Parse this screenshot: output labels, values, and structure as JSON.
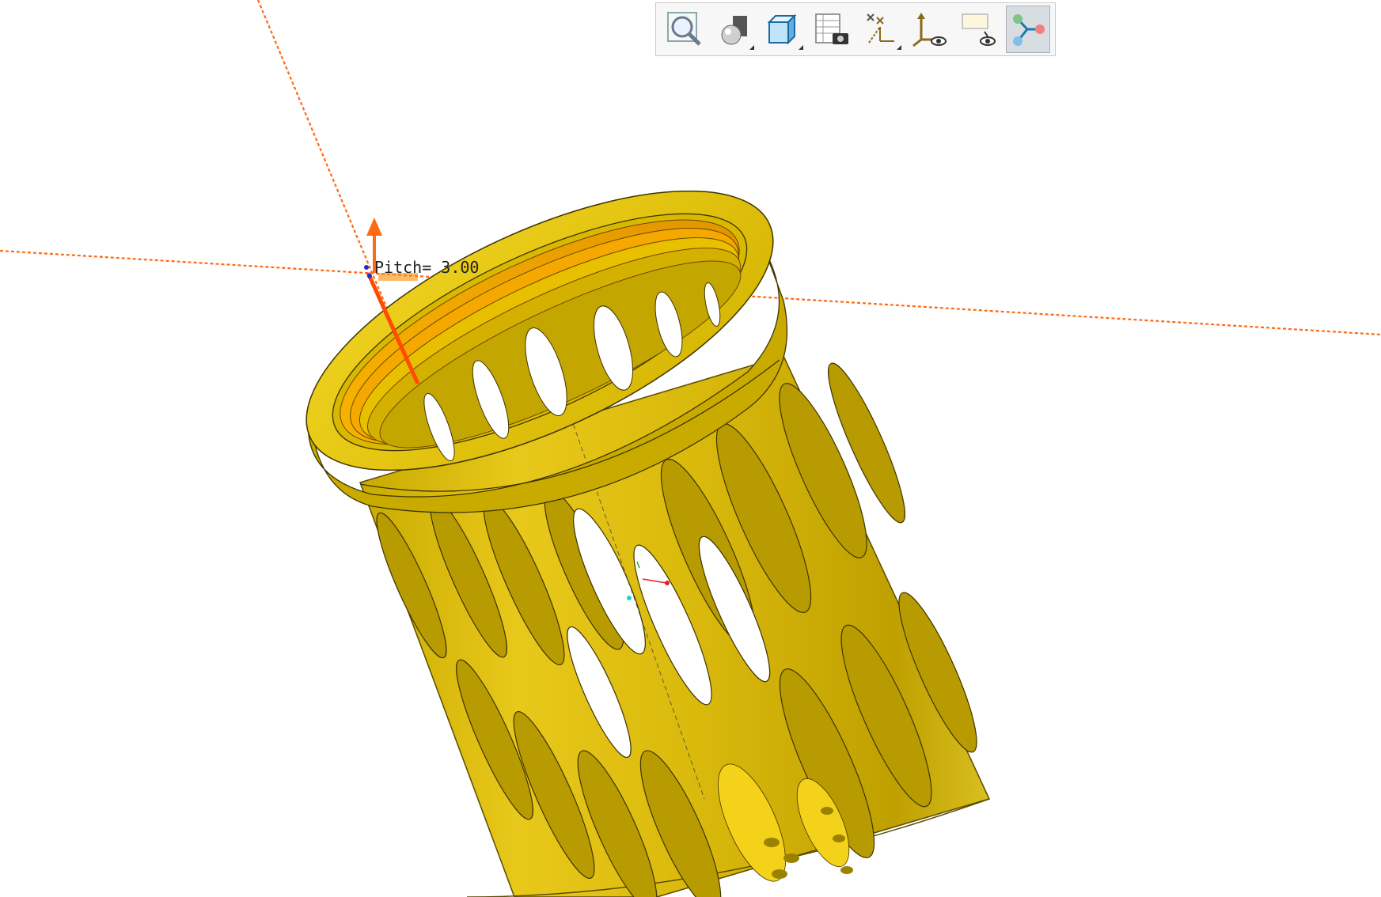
{
  "toolbar": {
    "buttons": [
      {
        "icon": "zoom-fit-icon",
        "active": false,
        "dropdown": false
      },
      {
        "icon": "display-style-icon",
        "active": false,
        "dropdown": true
      },
      {
        "icon": "saved-orientations-icon",
        "active": false,
        "dropdown": true
      },
      {
        "icon": "view-manager-icon",
        "active": false,
        "dropdown": false
      },
      {
        "icon": "datum-display-filters-icon",
        "active": false,
        "dropdown": true
      },
      {
        "icon": "csys-display-icon",
        "active": false,
        "dropdown": false
      },
      {
        "icon": "annotation-display-icon",
        "active": false,
        "dropdown": false
      },
      {
        "icon": "spin-center-icon",
        "active": true,
        "dropdown": false
      }
    ]
  },
  "model": {
    "color": "#e6c400",
    "annotation": {
      "pitch_label": "Pitch= 3.00"
    }
  },
  "colors": {
    "datum_axis": "#ff6a13",
    "model_yellow": "#e6c400",
    "model_dark": "#b79b00",
    "thread_orange": "#f5a300"
  }
}
